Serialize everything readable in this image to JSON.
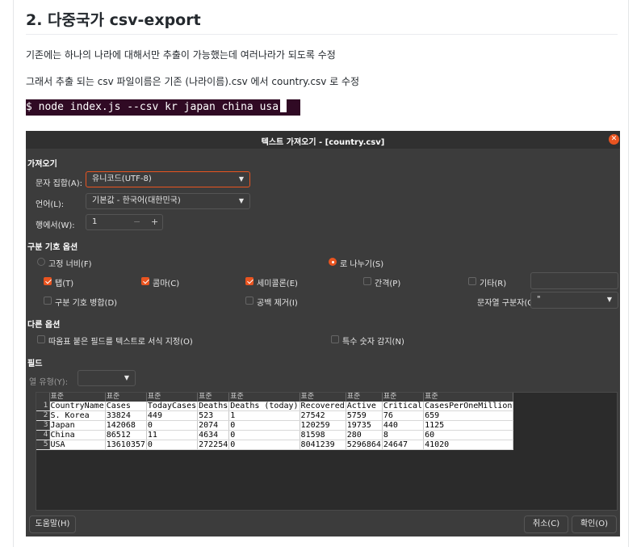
{
  "article": {
    "heading": "2. 다중국가 csv-export",
    "para1": "기존에는 하나의 나라에 대해서만 추출이 가능했는데 여러나라가 되도록 수정",
    "para2": "그래서 추출 되는 csv 파일이름은 기존 (나라이름).csv 에서 country.csv 로 수정",
    "terminal_command": "$ node index.js --csv kr japan china usa"
  },
  "dialog": {
    "title": "텍스트 가져오기 - [country.csv]",
    "close_icon": "close-icon",
    "import_section": "가져오기",
    "charset_label": "문자 집합(A):",
    "charset_value": "유니코드(UTF-8)",
    "language_label": "언어(L):",
    "language_value": "기본값 - 한국어(대한민국)",
    "from_row_label": "행에서(W):",
    "from_row_value": "1",
    "separator_section": "구분 기호 옵션",
    "fixed_width_label": "고정 너비(F)",
    "separated_by_label": "로 나누기(S)",
    "tab_label": "탭(T)",
    "comma_label": "콤마(C)",
    "semicolon_label": "세미콜론(E)",
    "space_label": "간격(P)",
    "other_label": "기타(R)",
    "merge_delimiters_label": "구분 기호 병합(D)",
    "trim_spaces_label": "공백 제거(I)",
    "string_delimiter_label": "문자열 구분자(G):",
    "string_delimiter_value": "\"",
    "other_options_section": "다른 옵션",
    "quoted_as_text_label": "따옴표 붙은 필드를 텍스트로 서식 지정(O)",
    "detect_special_numbers_label": "특수 숫자 감지(N)",
    "fields_section": "필드",
    "column_type_label": "열 유형(Y):",
    "help_button": "도움말(H)",
    "cancel_button": "취소(C)",
    "ok_button": "확인(O)"
  },
  "checks": {
    "fixed_width": false,
    "separated_by": true,
    "tab": true,
    "comma": true,
    "semicolon": true,
    "space": false,
    "other": false,
    "merge_delimiters": false,
    "trim_spaces": false,
    "quoted_as_text": false,
    "detect_special_numbers": false
  },
  "preview": {
    "column_type_header": "표준",
    "columns": [
      "CountryName",
      "Cases",
      "TodayCases",
      "Deaths",
      "Deaths (today)",
      "Recovered",
      "Active",
      "Critical",
      "CasesPerOneMillion"
    ],
    "rows": [
      {
        "n": "1",
        "cells": [
          "CountryName",
          "Cases",
          "TodayCases",
          "Deaths",
          "Deaths (today)",
          "Recovered",
          "Active",
          "Critical",
          "CasesPerOneMillion"
        ]
      },
      {
        "n": "2",
        "cells": [
          "S. Korea",
          "33824",
          "449",
          "523",
          "1",
          "27542",
          "5759",
          "76",
          "659"
        ]
      },
      {
        "n": "3",
        "cells": [
          "Japan",
          "142068",
          "0",
          "2074",
          "0",
          "120259",
          "19735",
          "440",
          "1125"
        ]
      },
      {
        "n": "4",
        "cells": [
          "China",
          "86512",
          "11",
          "4634",
          "0",
          "81598",
          "280",
          "8",
          "60"
        ]
      },
      {
        "n": "5",
        "cells": [
          "USA",
          "13610357",
          "0",
          "272254",
          "0",
          "8041239",
          "5296864",
          "24647",
          "41020"
        ]
      }
    ]
  },
  "colors": {
    "accent": "#e95420",
    "dialog_bg": "#3c3c3c",
    "terminal_bg": "#300a24"
  }
}
